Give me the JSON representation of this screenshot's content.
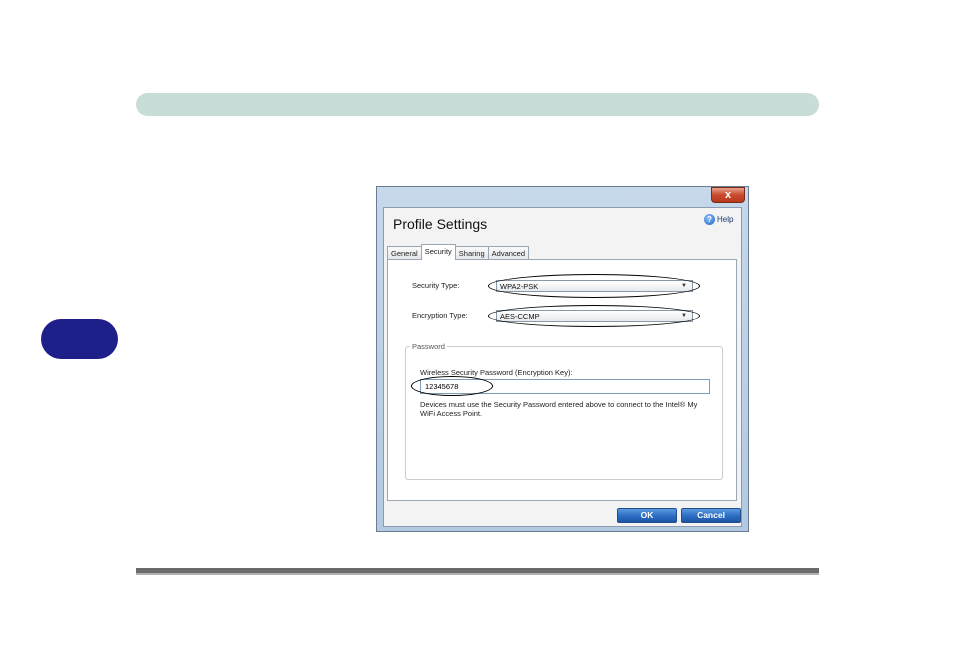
{
  "dialog": {
    "close_glyph": "x",
    "title": "Profile Settings",
    "help_label": "Help",
    "help_glyph": "?",
    "tabs": [
      {
        "label": "General"
      },
      {
        "label": "Security"
      },
      {
        "label": "Sharing"
      },
      {
        "label": "Advanced"
      }
    ],
    "active_tab": "Security",
    "security_type": {
      "label": "Security Type:",
      "value": "WPA2-PSK"
    },
    "encryption_type": {
      "label": "Encryption Type:",
      "value": "AES-CCMP"
    },
    "password_group": {
      "legend": "Password",
      "field_label": "Wireless Security Password (Encryption Key):",
      "value": "12345678",
      "note": "Devices must use the Security Password entered above to connect to the Intel® My WiFi Access Point."
    },
    "buttons": {
      "ok": "OK",
      "cancel": "Cancel"
    },
    "dropdown_arrow": "▼"
  },
  "colors": {
    "top_bar": "#c8dcd8",
    "side_tab": "#1f1f8c",
    "button_blue": "#2b6cc4",
    "close_red": "#c94a2c"
  }
}
